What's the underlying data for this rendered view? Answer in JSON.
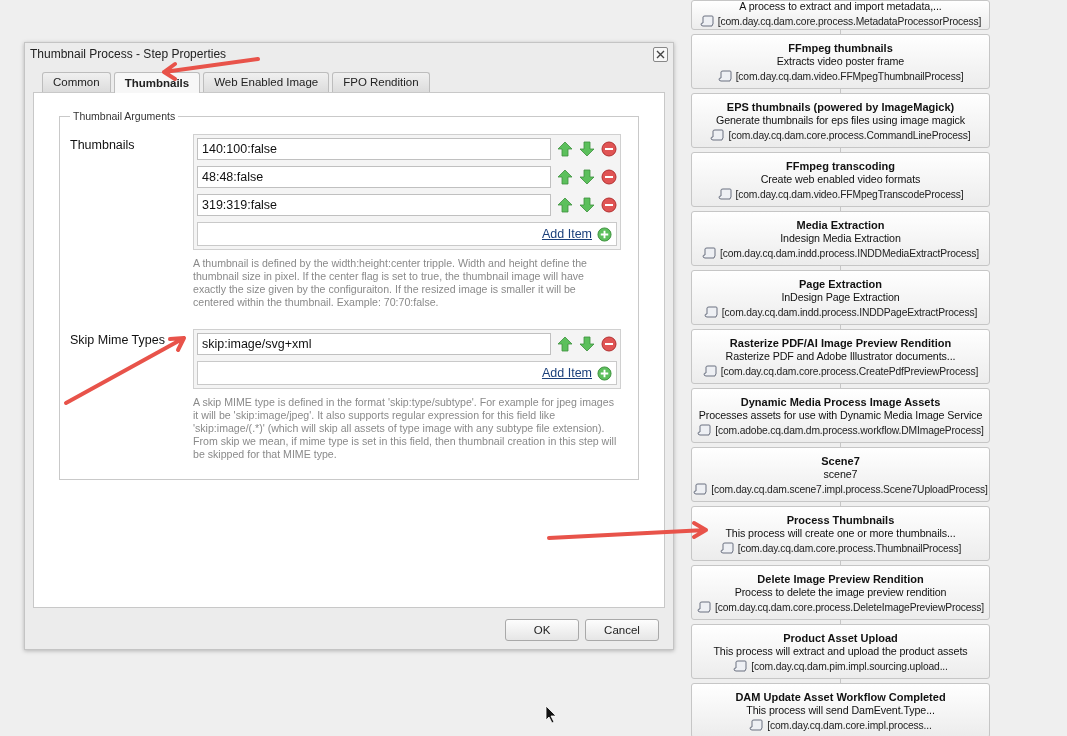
{
  "dialog": {
    "title": "Thumbnail Process - Step Properties",
    "tabs": [
      {
        "label": "Common",
        "selected": false
      },
      {
        "label": "Thumbnails",
        "selected": true
      },
      {
        "label": "Web Enabled Image",
        "selected": false
      },
      {
        "label": "FPO Rendition",
        "selected": false
      }
    ],
    "fieldset": {
      "legend": "Thumbnail Arguments",
      "fields": [
        {
          "label": "Thumbnails",
          "items": [
            "140:100:false",
            "48:48:false",
            "319:319:false"
          ],
          "add_label": "Add Item",
          "help": "A thumbnail is defined by the width:height:center tripple. Width and height define the thumbnail size in pixel. If the center flag is set to true, the thumbnail image will have exactly the size given by the configuraiton. If the resized image is smaller it will be centered within the thumbnail. Example: 70:70:false."
        },
        {
          "label": "Skip Mime Types",
          "items": [
            "skip:image/svg+xml"
          ],
          "add_label": "Add Item",
          "help": "A skip MIME type is defined in the format 'skip:type/subtype'. For example for jpeg images it will be 'skip:image/jpeg'. It also supports regular expression for this field like 'skip:image/(.*)' (which will skip all assets of type image with any subtype file extension). From skip we mean, if mime type is set in this field, then thumbnail creation in this step will be skipped for that MIME type."
        }
      ]
    },
    "buttons": [
      "OK",
      "Cancel"
    ]
  },
  "steps": [
    {
      "description": "A process to extract and import metadata,...",
      "class": "[com.day.cq.dam.core.process.MetadataProcessorProcess]"
    },
    {
      "title": "FFmpeg thumbnails",
      "description": "Extracts video poster frame",
      "class": "[com.day.cq.dam.video.FFMpegThumbnailProcess]"
    },
    {
      "title": "EPS thumbnails (powered by ImageMagick)",
      "description": "Generate thumbnails for eps files using image magick",
      "class": "[com.day.cq.dam.core.process.CommandLineProcess]"
    },
    {
      "title": "FFmpeg transcoding",
      "description": "Create web enabled video formats",
      "class": "[com.day.cq.dam.video.FFMpegTranscodeProcess]"
    },
    {
      "title": "Media Extraction",
      "description": "Indesign Media Extraction",
      "class": "[com.day.cq.dam.indd.process.INDDMediaExtractProcess]"
    },
    {
      "title": "Page Extraction",
      "description": "InDesign Page Extraction",
      "class": "[com.day.cq.dam.indd.process.INDDPageExtractProcess]"
    },
    {
      "title": "Rasterize PDF/AI Image Preview Rendition",
      "description": "Rasterize PDF and Adobe Illustrator documents...",
      "class": "[com.day.cq.dam.core.process.CreatePdfPreviewProcess]"
    },
    {
      "title": "Dynamic Media Process Image Assets",
      "description": "Processes assets for use with Dynamic Media Image Service",
      "class": "[com.adobe.cq.dam.dm.process.workflow.DMImageProcess]"
    },
    {
      "title": "Scene7",
      "description": "scene7",
      "class": "[com.day.cq.dam.scene7.impl.process.Scene7UploadProcess]"
    },
    {
      "title": "Process Thumbnails",
      "description": "This process will create one or more thumbnails...",
      "class": "[com.day.cq.dam.core.process.ThumbnailProcess]"
    },
    {
      "title": "Delete Image Preview Rendition",
      "description": "Process to delete the image preview rendition",
      "class": "[com.day.cq.dam.core.process.DeleteImagePreviewProcess]"
    },
    {
      "title": "Product Asset Upload",
      "description": "This process will extract and upload the product assets",
      "class": "[com.day.cq.dam.pim.impl.sourcing.upload..."
    },
    {
      "title": "DAM Update Asset Workflow Completed",
      "description": "This process will send DamEvent.Type...",
      "class": "[com.day.cq.dam.core.impl.process..."
    }
  ]
}
